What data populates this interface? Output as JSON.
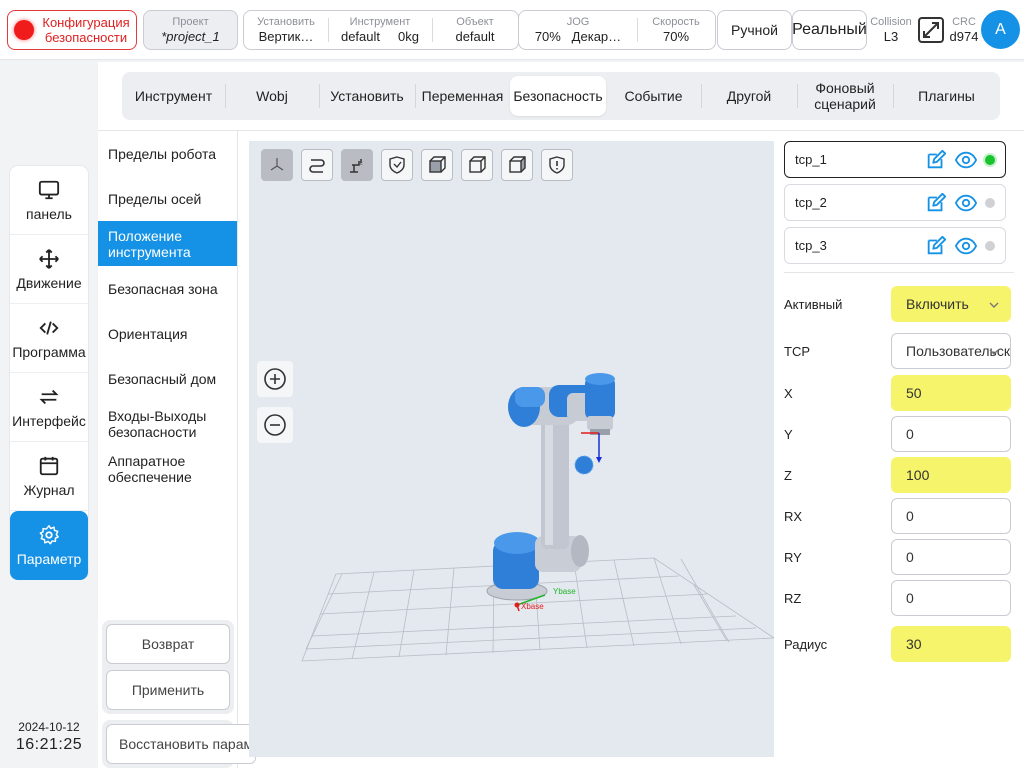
{
  "topbar": {
    "safety_label": "Конфигурация\nбезопасности",
    "project": {
      "label": "Проект",
      "value": "*project_1"
    },
    "group1": [
      {
        "label": "Установить",
        "value": "Вертик…"
      },
      {
        "label": "Инструмент",
        "value": "default     0kg"
      },
      {
        "label": "Объект",
        "value": "default"
      }
    ],
    "group2": [
      {
        "label": "JOG",
        "value": "70%   Декар…"
      },
      {
        "label": "Скорость",
        "value": "70%"
      }
    ],
    "manual_label": "Ручной",
    "real_label": "Реальный",
    "collision": {
      "label": "Collision",
      "value": "L3"
    },
    "crc": {
      "label": "CRC",
      "value": "d974"
    },
    "avatar_letter": "A",
    "colors": {
      "accent": "#1592e6",
      "alarm": "#f01c1c"
    }
  },
  "leftnav": {
    "items": [
      {
        "label": "панель",
        "icon": "monitor-icon"
      },
      {
        "label": "Движение",
        "icon": "move-arrows-icon"
      },
      {
        "label": "Программа",
        "icon": "code-icon"
      },
      {
        "label": "Интерфейс",
        "icon": "swap-arrows-icon"
      },
      {
        "label": "Журнал",
        "icon": "calendar-icon"
      },
      {
        "label": "Параметр",
        "icon": "gear-icon"
      }
    ],
    "active_index": 5,
    "date": "2024-10-12",
    "time": "16:21:25"
  },
  "tabs": {
    "items": [
      "Инструмент",
      "Wobj",
      "Установить",
      "Переменная",
      "Безопасность",
      "Событие",
      "Другой",
      "Фоновый сценарий",
      "Плагины"
    ],
    "active_index": 4
  },
  "subnav": {
    "items": [
      "Пределы робота",
      "Пределы осей",
      "Положение инструмента",
      "Безопасная зона",
      "Ориентация",
      "Безопасный дом",
      "Входы-Выходы безопасности",
      "Аппаратное обеспечение"
    ],
    "active_index": 2,
    "back_label": "Возврат",
    "apply_label": "Применить",
    "restore_label": "Восстановить парам"
  },
  "viewport": {
    "tools": [
      "axes-view-icon",
      "path-icon",
      "robot-tcp-icon",
      "shield-check-icon",
      "cube-front-icon",
      "cube-side-icon",
      "cube-iso-icon",
      "shield-alert-icon"
    ],
    "tools_on": [
      0,
      2
    ],
    "axis_labels": {
      "x": "Xbase",
      "y": "Ybase"
    }
  },
  "tcp_list": [
    {
      "name": "tcp_1",
      "active": true
    },
    {
      "name": "tcp_2",
      "active": false
    },
    {
      "name": "tcp_3",
      "active": false
    }
  ],
  "form": {
    "active": {
      "label": "Активный",
      "value": "Включить"
    },
    "tcp": {
      "label": "TCP",
      "value": "Пользовательский"
    },
    "x": {
      "label": "X",
      "value": "50"
    },
    "y": {
      "label": "Y",
      "value": "0"
    },
    "z": {
      "label": "Z",
      "value": "100"
    },
    "rx": {
      "label": "RX",
      "value": "0"
    },
    "ry": {
      "label": "RY",
      "value": "0"
    },
    "rz": {
      "label": "RZ",
      "value": "0"
    },
    "radius": {
      "label": "Радиус",
      "value": "30"
    }
  }
}
